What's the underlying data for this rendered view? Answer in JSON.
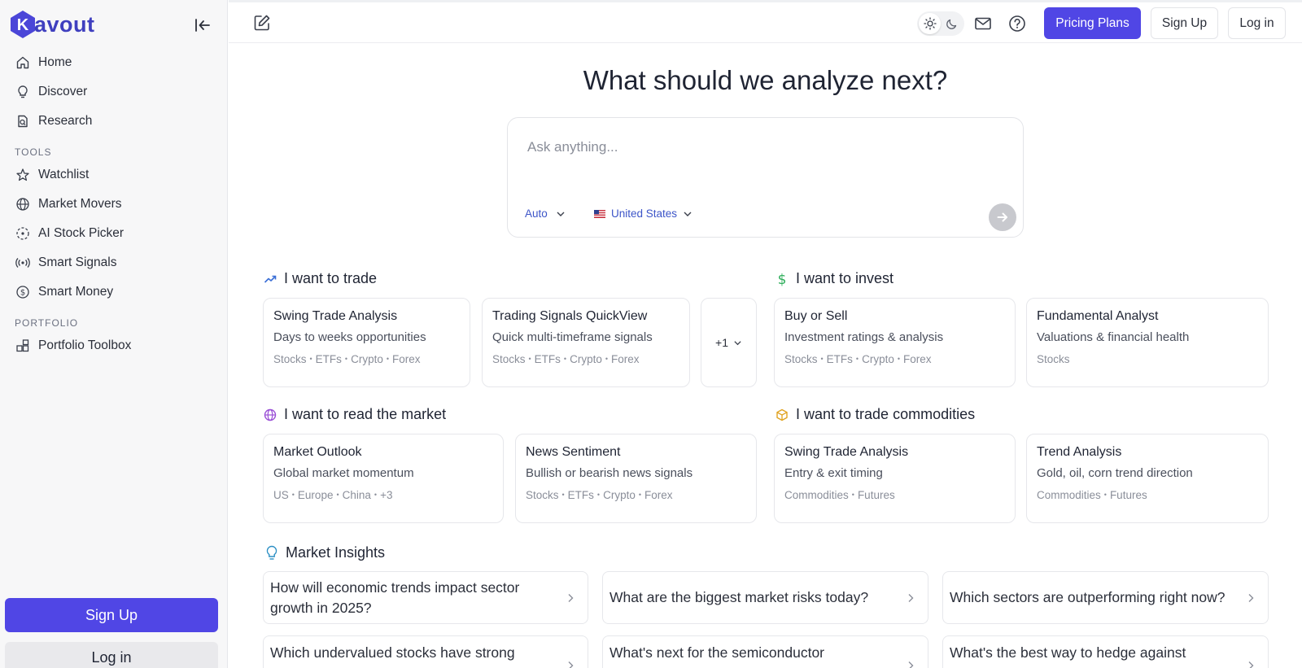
{
  "brand": {
    "name": "avout",
    "mark_letter": "K",
    "color": "#5046e5"
  },
  "sidebar": {
    "primary": [
      {
        "label": "Home",
        "icon": "home-icon"
      },
      {
        "label": "Discover",
        "icon": "lightbulb-icon"
      },
      {
        "label": "Research",
        "icon": "research-icon"
      }
    ],
    "tools_heading": "TOOLS",
    "tools": [
      {
        "label": "Watchlist",
        "icon": "star-icon"
      },
      {
        "label": "Market Movers",
        "icon": "globe-icon"
      },
      {
        "label": "AI Stock Picker",
        "icon": "target-icon"
      },
      {
        "label": "Smart Signals",
        "icon": "signal-icon"
      },
      {
        "label": "Smart Money",
        "icon": "dollar-icon"
      }
    ],
    "portfolio_heading": "PORTFOLIO",
    "portfolio": [
      {
        "label": "Portfolio Toolbox",
        "icon": "toolbox-icon"
      }
    ],
    "signup_label": "Sign Up",
    "login_label": "Log in"
  },
  "topbar": {
    "pricing_label": "Pricing Plans",
    "signup_label": "Sign Up",
    "login_label": "Log in"
  },
  "main": {
    "headline": "What should we analyze next?",
    "ask": {
      "placeholder": "Ask anything...",
      "mode": "Auto",
      "region": "United States"
    },
    "sections": {
      "trade": {
        "title": "I want to trade",
        "cards": [
          {
            "title": "Swing Trade Analysis",
            "desc": "Days to weeks opportunities",
            "tags": [
              "Stocks",
              "ETFs",
              "Crypto",
              "Forex"
            ]
          },
          {
            "title": "Trading Signals QuickView",
            "desc": "Quick multi-timeframe signals",
            "tags": [
              "Stocks",
              "ETFs",
              "Crypto",
              "Forex"
            ]
          }
        ],
        "more_label": "+1"
      },
      "invest": {
        "title": "I want to invest",
        "cards": [
          {
            "title": "Buy or Sell",
            "desc": "Investment ratings & analysis",
            "tags": [
              "Stocks",
              "ETFs",
              "Crypto",
              "Forex"
            ]
          },
          {
            "title": "Fundamental Analyst",
            "desc": "Valuations & financial health",
            "tags": [
              "Stocks"
            ]
          }
        ]
      },
      "read": {
        "title": "I want to read the market",
        "cards": [
          {
            "title": "Market Outlook",
            "desc": "Global market momentum",
            "tags": [
              "US",
              "Europe",
              "China",
              "+3"
            ]
          },
          {
            "title": "News Sentiment",
            "desc": "Bullish or bearish news signals",
            "tags": [
              "Stocks",
              "ETFs",
              "Crypto",
              "Forex"
            ]
          }
        ]
      },
      "commodities": {
        "title": "I want to trade commodities",
        "cards": [
          {
            "title": "Swing Trade Analysis",
            "desc": "Entry & exit timing",
            "tags": [
              "Commodities",
              "Futures"
            ]
          },
          {
            "title": "Trend Analysis",
            "desc": "Gold, oil, corn trend direction",
            "tags": [
              "Commodities",
              "Futures"
            ]
          }
        ]
      },
      "insights": {
        "title": "Market Insights",
        "items": [
          "How will economic trends impact sector growth in 2025?",
          "What are the biggest market risks today?",
          "Which sectors are outperforming right now?",
          "Which undervalued stocks have strong",
          "What's next for the semiconductor",
          "What's the best way to hedge against"
        ]
      }
    }
  },
  "colors": {
    "accent": "#5046e5",
    "link": "#3d55c8",
    "trade_icon": "#3b6fd6",
    "invest_icon": "#2fae5b",
    "read_icon": "#9a4fd6",
    "commodities_icon": "#e0a321",
    "insights_icon": "#2b8fc4"
  }
}
